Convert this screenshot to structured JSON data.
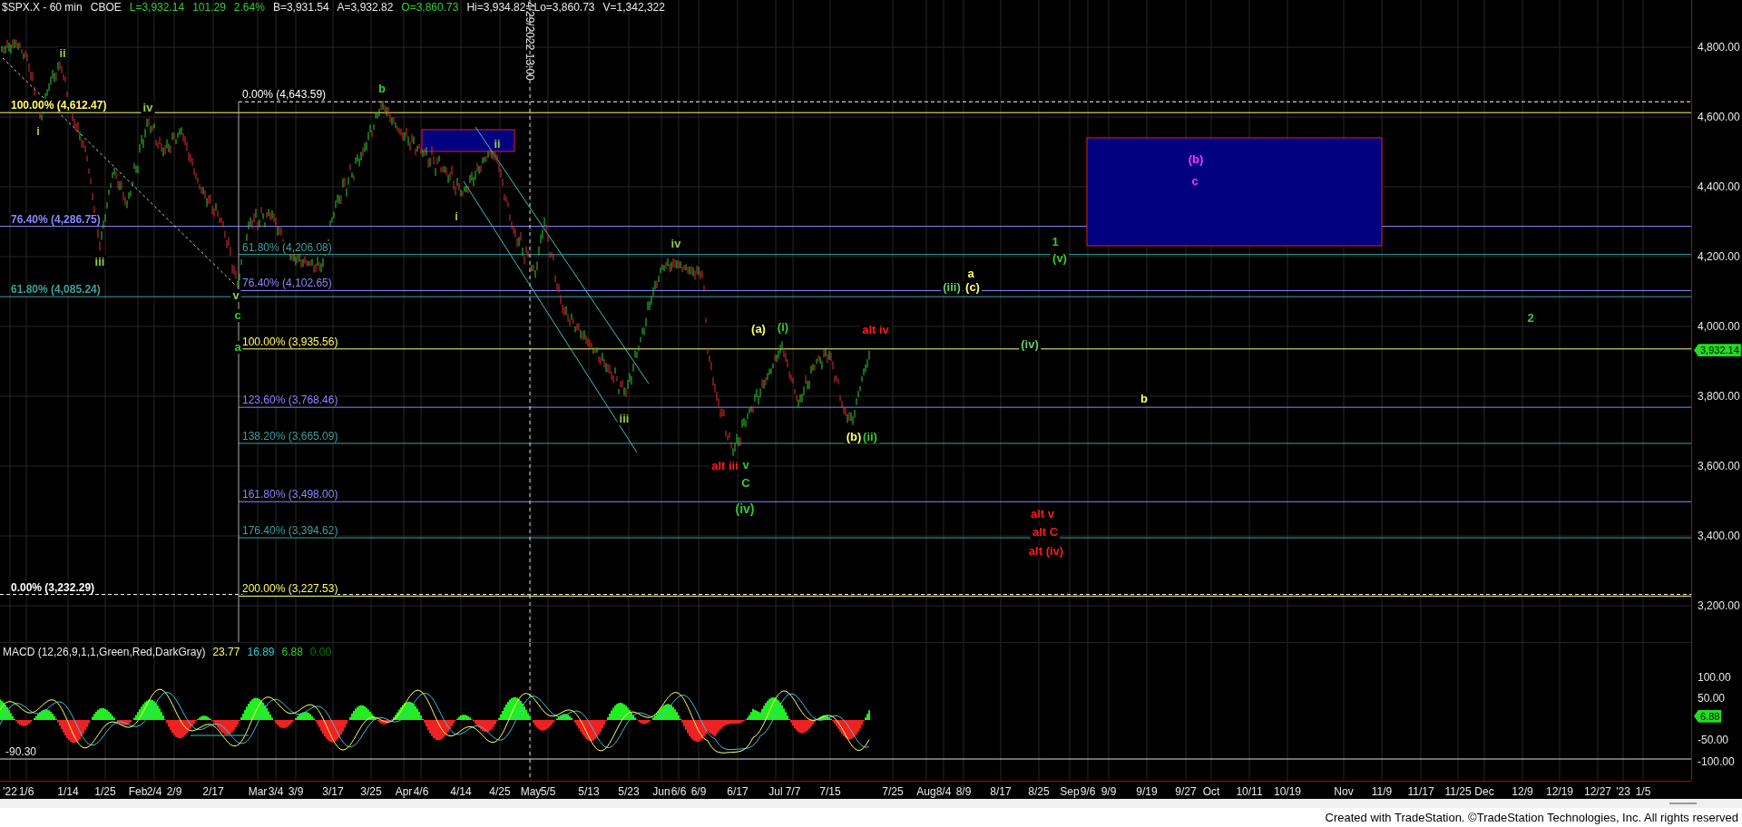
{
  "header": {
    "symbol": "$SPX.X - 60 min",
    "exchange": "CBOE",
    "quotes": [
      {
        "text": "L=3,932.14",
        "color": "#33cc33"
      },
      {
        "text": "101.29",
        "color": "#33cc33"
      },
      {
        "text": "2.64%",
        "color": "#33cc33"
      },
      {
        "text": "B=3,931.54",
        "color": "#e8e8e8"
      },
      {
        "text": "A=3,932.82",
        "color": "#e8e8e8"
      },
      {
        "text": "O=3,860.73",
        "color": "#33cc33"
      },
      {
        "text": "Hi=3,934.82",
        "color": "#e8e8e8"
      },
      {
        "text": "Lo=3,860.73",
        "color": "#e8e8e8"
      },
      {
        "text": "V=1,342,322",
        "color": "#e8e8e8"
      }
    ]
  },
  "time_marker": {
    "label": "4/29/2022 13:00"
  },
  "retracement_levels": [
    {
      "label": "100.00% (4,612.47)",
      "color": "#ffff66"
    },
    {
      "label": "76.40% (4,286.75)",
      "color": "#8888ff"
    },
    {
      "label": "61.80% (4,085.24)",
      "color": "#3f9f9f"
    },
    {
      "label": "0.00% (3,232.29)",
      "color": "#ffffff"
    }
  ],
  "extension_levels": [
    {
      "label": "0.00% (4,643.59)",
      "color": "#ffffff"
    },
    {
      "label": "61.80% (4,206.08)",
      "color": "#3f9f9f"
    },
    {
      "label": "76.40% (4,102.65)",
      "color": "#8888ff"
    },
    {
      "label": "100.00% (3,935.56)",
      "color": "#ffff66"
    },
    {
      "label": "123.60% (3,768.46)",
      "color": "#8888ff"
    },
    {
      "label": "138.20% (3,665.09)",
      "color": "#3f9f9f"
    },
    {
      "label": "161.80% (3,498.00)",
      "color": "#8888ff"
    },
    {
      "label": "176.40% (3,394.62)",
      "color": "#3f9f9f"
    },
    {
      "label": "200.00% (3,227.53)",
      "color": "#ffff66"
    }
  ],
  "wave_labels": [
    {
      "text": "ii",
      "color": "#8fcf3f"
    },
    {
      "text": "i",
      "color": "#8fcf3f"
    },
    {
      "text": "iv",
      "color": "#8fcf3f"
    },
    {
      "text": "iii",
      "color": "#8fcf3f"
    },
    {
      "text": "v",
      "color": "#8fcf3f"
    },
    {
      "text": "c",
      "color": "#33cc33"
    },
    {
      "text": "a",
      "color": "#33cc33"
    },
    {
      "text": "b",
      "color": "#33cc33"
    },
    {
      "text": "ii",
      "color": "#8fcf3f"
    },
    {
      "text": "i",
      "color": "#8fcf3f"
    },
    {
      "text": "iv",
      "color": "#8fcf3f"
    },
    {
      "text": "iii",
      "color": "#8fcf3f"
    },
    {
      "text": "(a)",
      "color": "#ffff66"
    },
    {
      "text": "(i)",
      "color": "#33cc33"
    },
    {
      "text": "alt iii",
      "color": "#ff1a1a"
    },
    {
      "text": "v",
      "color": "#33cc33"
    },
    {
      "text": "C",
      "color": "#33cc33"
    },
    {
      "text": "(iv)",
      "color": "#33cc33"
    },
    {
      "text": "(b)",
      "color": "#ffff66"
    },
    {
      "text": "(ii)",
      "color": "#33cc33"
    },
    {
      "text": "alt iv",
      "color": "#ff1a1a"
    },
    {
      "text": "(b)",
      "color": "#ff33ff"
    },
    {
      "text": "c",
      "color": "#ff33ff"
    },
    {
      "text": "1",
      "color": "#33cc33"
    },
    {
      "text": "(v)",
      "color": "#33cc33"
    },
    {
      "text": "a",
      "color": "#ffff66"
    },
    {
      "text": "(iii)",
      "color": "#66cc66"
    },
    {
      "text": "(c)",
      "color": "#ffff66"
    },
    {
      "text": "2",
      "color": "#33cc33"
    },
    {
      "text": "(iv)",
      "color": "#66cc66"
    },
    {
      "text": "b",
      "color": "#ffff66"
    },
    {
      "text": "alt v",
      "color": "#ff1a1a"
    },
    {
      "text": "alt C",
      "color": "#ff1a1a"
    },
    {
      "text": "alt (iv)",
      "color": "#ff1a1a"
    }
  ],
  "price_axis": {
    "ticks": [
      "4,800.00",
      "4,600.00",
      "4,400.00",
      "4,200.00",
      "4,000.00",
      "3,800.00",
      "3,600.00",
      "3,400.00",
      "3,200.00"
    ],
    "last_price": "3,932.14"
  },
  "macd": {
    "title": "MACD (12,26,9,1,1,Green,Red,DarkGray)",
    "values": [
      {
        "text": "23.77",
        "color": "#ffff66"
      },
      {
        "text": "16.89",
        "color": "#33cccc"
      },
      {
        "text": "6.88",
        "color": "#33cc33"
      },
      {
        "text": "0.00",
        "color": "#008000"
      }
    ],
    "low_marker": "-90.30",
    "ticks": [
      "100.00",
      "50.00",
      "-50.00",
      "-100.00"
    ],
    "last_value": "6.88"
  },
  "date_axis": [
    "'22",
    "1/6",
    "1/14",
    "1/25",
    "Feb",
    "2/4",
    "2/9",
    "2/17",
    "Mar",
    "3/4",
    "3/9",
    "3/17",
    "3/25",
    "Apr",
    "4/6",
    "4/14",
    "4/25",
    "May",
    "5/5",
    "5/13",
    "5/23",
    "Jun",
    "6/6",
    "6/9",
    "6/17",
    "Jul",
    "7/7",
    "7/15",
    "7/25",
    "Aug",
    "8/4",
    "8/9",
    "8/17",
    "8/25",
    "Sep",
    "9/6",
    "9/9",
    "9/19",
    "9/27",
    "Oct",
    "10/11",
    "10/19",
    "Nov",
    "11/9",
    "11/17",
    "11/25",
    "Dec",
    "12/9",
    "12/19",
    "12/27",
    "'23",
    "1/5"
  ],
  "footer": "Created with TradeStation. ©TradeStation Technologies, Inc. All rights reserved"
}
